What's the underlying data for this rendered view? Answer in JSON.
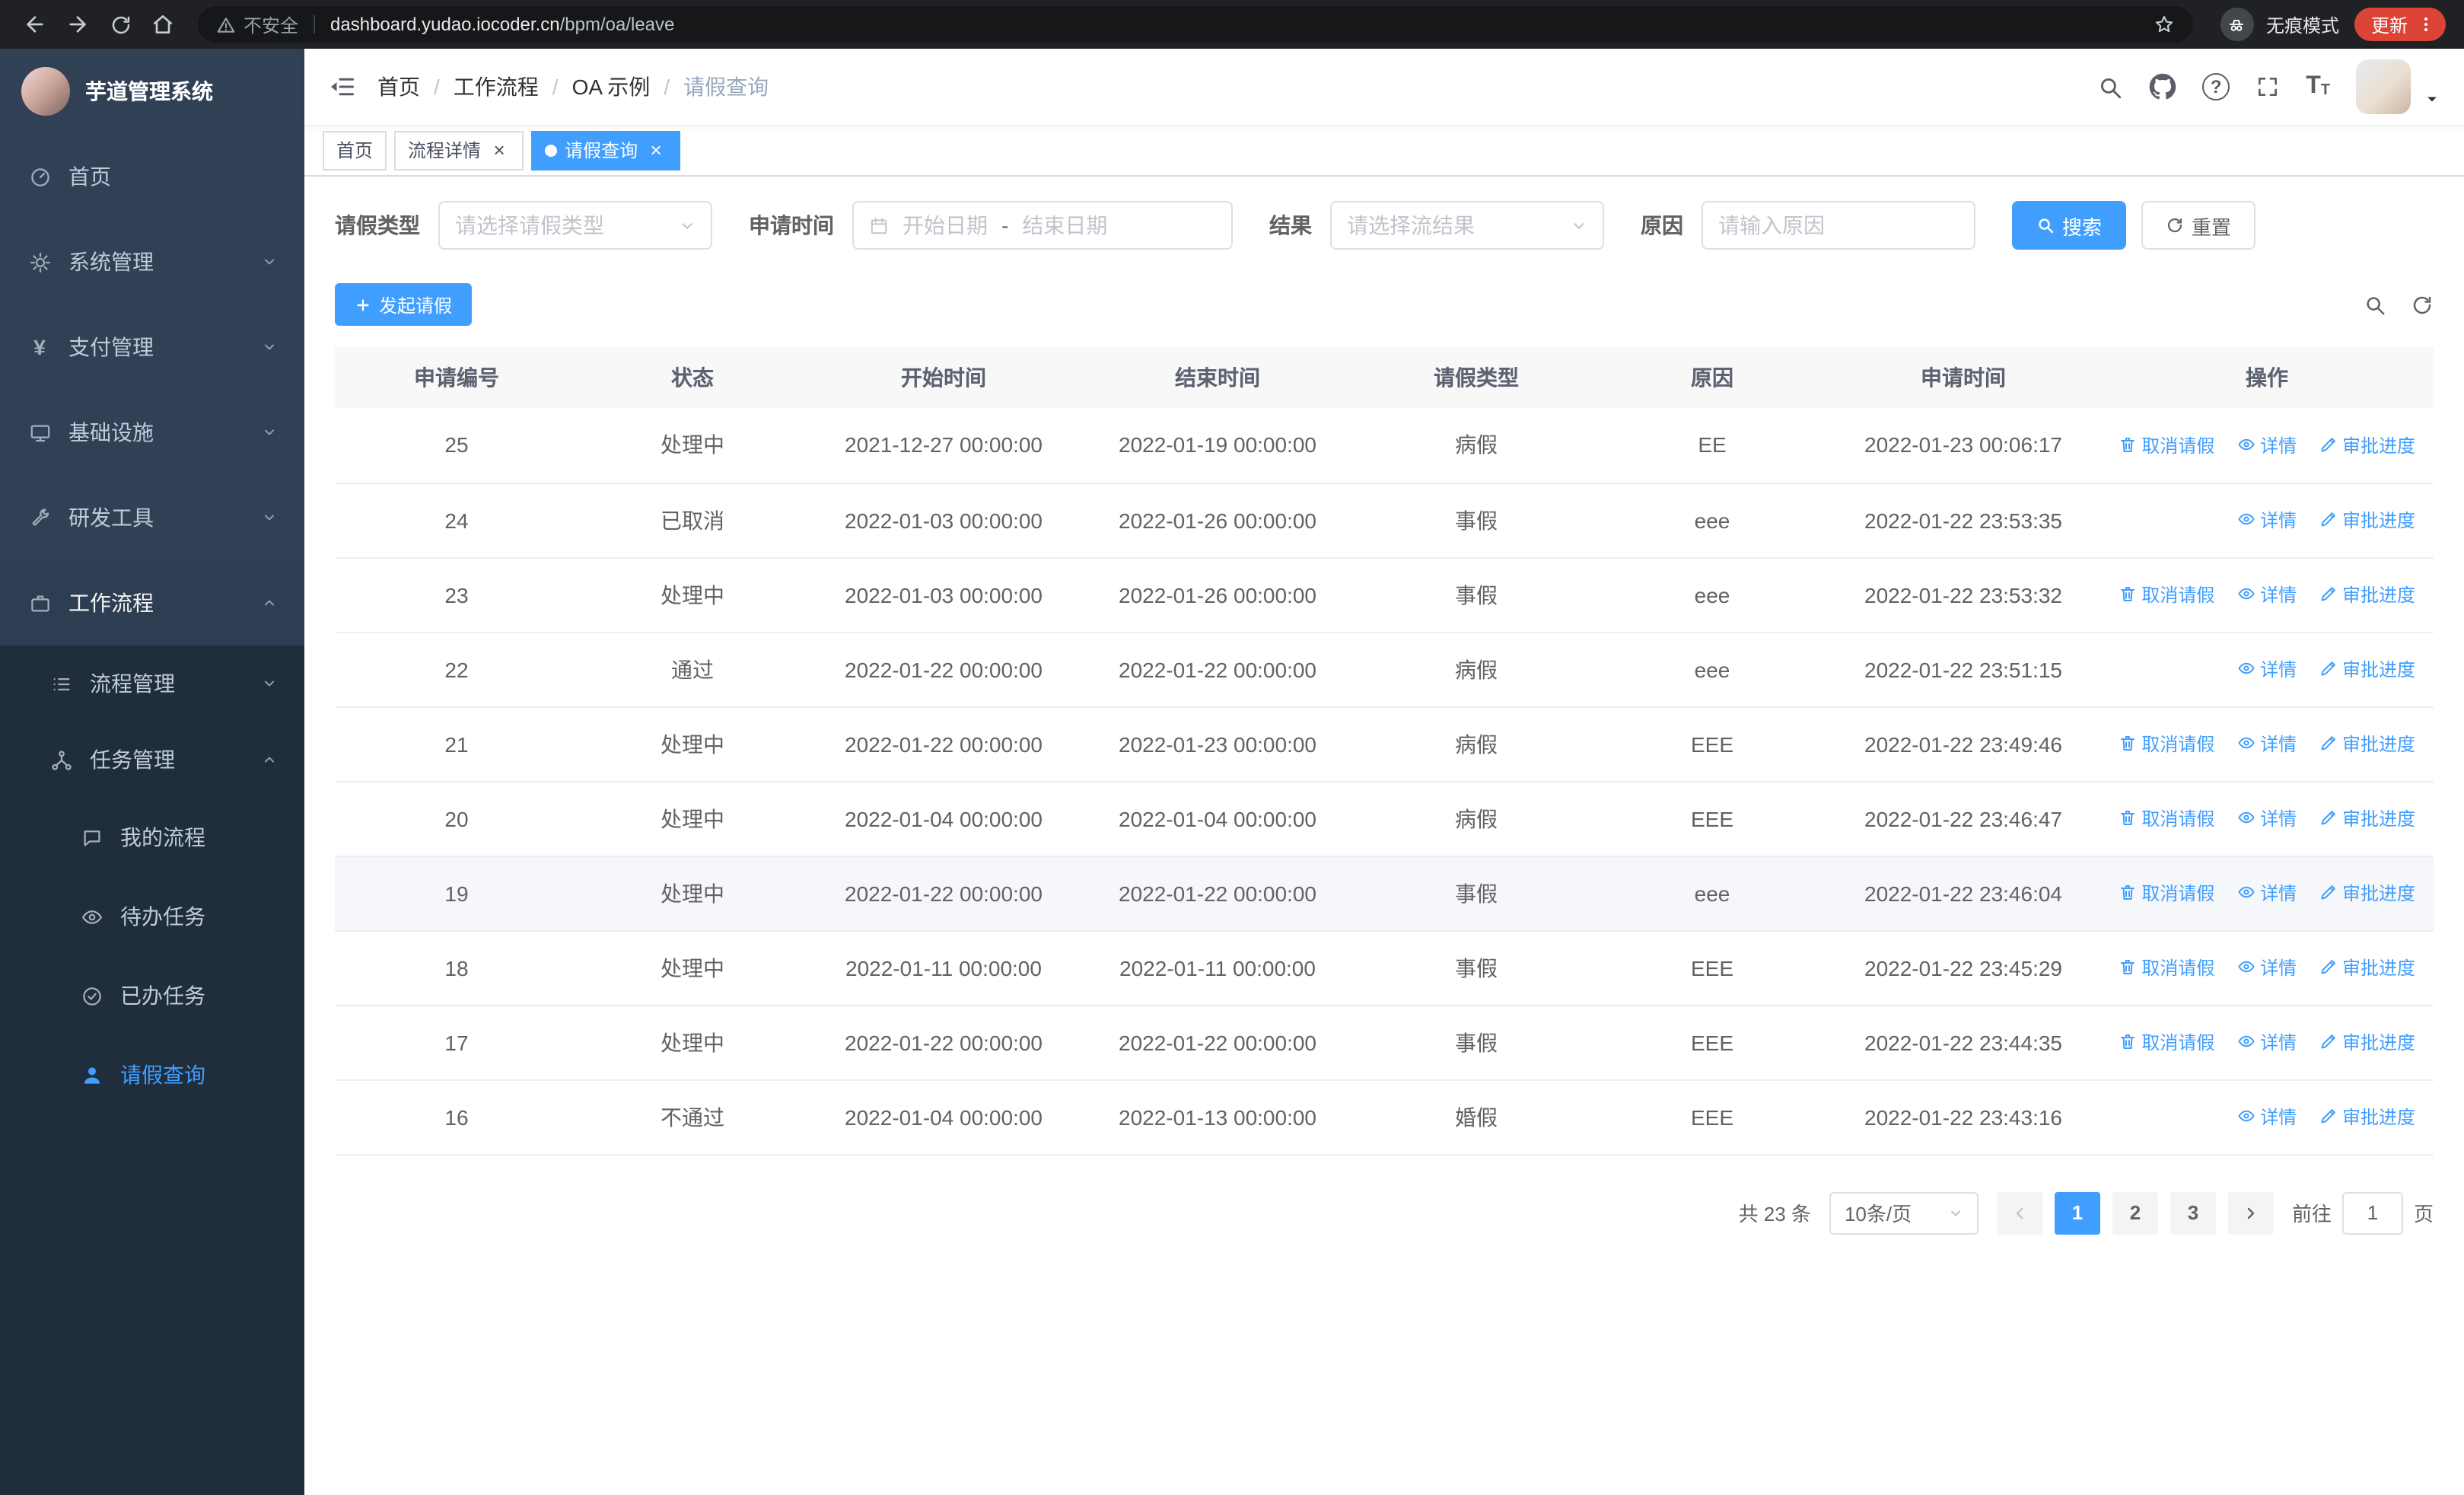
{
  "browser": {
    "security_label": "不安全",
    "url_domain": "dashboard.yudao.iocoder.cn",
    "url_path": "/bpm/oa/leave",
    "incognito_label": "无痕模式",
    "update_label": "更新"
  },
  "sidebar": {
    "title": "芋道管理系统",
    "items": [
      {
        "label": "首页",
        "icon": "dashboard-icon"
      },
      {
        "label": "系统管理",
        "icon": "gear-icon"
      },
      {
        "label": "支付管理",
        "icon": "payment-icon"
      },
      {
        "label": "基础设施",
        "icon": "monitor-icon"
      },
      {
        "label": "研发工具",
        "icon": "tool-icon"
      },
      {
        "label": "工作流程",
        "icon": "workflow-icon",
        "expanded": true
      }
    ],
    "submenu": [
      {
        "label": "流程管理",
        "icon": "process-icon"
      },
      {
        "label": "任务管理",
        "icon": "task-icon",
        "expanded": true
      }
    ],
    "leaves": [
      {
        "label": "我的流程",
        "icon": "chat-icon"
      },
      {
        "label": "待办任务",
        "icon": "eye-icon"
      },
      {
        "label": "已办任务",
        "icon": "done-icon"
      },
      {
        "label": "请假查询",
        "icon": "user-icon",
        "active": true
      }
    ]
  },
  "header": {
    "breadcrumb": [
      "首页",
      "工作流程",
      "OA 示例",
      "请假查询"
    ],
    "separator": "/",
    "help_glyph": "?",
    "font_icon": "T"
  },
  "tabs": {
    "close_glyph": "×",
    "items": [
      {
        "label": "首页",
        "active": false,
        "closable": false
      },
      {
        "label": "流程详情",
        "active": false,
        "closable": true
      },
      {
        "label": "请假查询",
        "active": true,
        "closable": true
      }
    ]
  },
  "filters": {
    "leave_type_label": "请假类型",
    "leave_type_placeholder": "请选择请假类型",
    "apply_time_label": "申请时间",
    "start_date_placeholder": "开始日期",
    "date_separator": "-",
    "end_date_placeholder": "结束日期",
    "result_label": "结果",
    "result_placeholder": "请选择流结果",
    "reason_label": "原因",
    "reason_placeholder": "请输入原因",
    "search_label": "搜索",
    "reset_label": "重置"
  },
  "toolbar": {
    "create_label": "发起请假"
  },
  "table": {
    "columns": [
      "申请编号",
      "状态",
      "开始时间",
      "结束时间",
      "请假类型",
      "原因",
      "申请时间",
      "操作"
    ],
    "action_labels": {
      "cancel": "取消请假",
      "detail": "详情",
      "progress": "审批进度"
    },
    "rows": [
      {
        "id": "25",
        "status": "处理中",
        "start": "2021-12-27 00:00:00",
        "end": "2022-01-19 00:00:00",
        "type": "病假",
        "reason": "EE",
        "apply_time": "2022-01-23 00:06:17",
        "actions": [
          "cancel",
          "detail",
          "progress"
        ]
      },
      {
        "id": "24",
        "status": "已取消",
        "start": "2022-01-03 00:00:00",
        "end": "2022-01-26 00:00:00",
        "type": "事假",
        "reason": "eee",
        "apply_time": "2022-01-22 23:53:35",
        "actions": [
          "detail",
          "progress"
        ]
      },
      {
        "id": "23",
        "status": "处理中",
        "start": "2022-01-03 00:00:00",
        "end": "2022-01-26 00:00:00",
        "type": "事假",
        "reason": "eee",
        "apply_time": "2022-01-22 23:53:32",
        "actions": [
          "cancel",
          "detail",
          "progress"
        ]
      },
      {
        "id": "22",
        "status": "通过",
        "start": "2022-01-22 00:00:00",
        "end": "2022-01-22 00:00:00",
        "type": "病假",
        "reason": "eee",
        "apply_time": "2022-01-22 23:51:15",
        "actions": [
          "detail",
          "progress"
        ]
      },
      {
        "id": "21",
        "status": "处理中",
        "start": "2022-01-22 00:00:00",
        "end": "2022-01-23 00:00:00",
        "type": "病假",
        "reason": "EEE",
        "apply_time": "2022-01-22 23:49:46",
        "actions": [
          "cancel",
          "detail",
          "progress"
        ]
      },
      {
        "id": "20",
        "status": "处理中",
        "start": "2022-01-04 00:00:00",
        "end": "2022-01-04 00:00:00",
        "type": "病假",
        "reason": "EEE",
        "apply_time": "2022-01-22 23:46:47",
        "actions": [
          "cancel",
          "detail",
          "progress"
        ]
      },
      {
        "id": "19",
        "status": "处理中",
        "start": "2022-01-22 00:00:00",
        "end": "2022-01-22 00:00:00",
        "type": "事假",
        "reason": "eee",
        "apply_time": "2022-01-22 23:46:04",
        "actions": [
          "cancel",
          "detail",
          "progress"
        ],
        "highlight": true
      },
      {
        "id": "18",
        "status": "处理中",
        "start": "2022-01-11 00:00:00",
        "end": "2022-01-11 00:00:00",
        "type": "事假",
        "reason": "EEE",
        "apply_time": "2022-01-22 23:45:29",
        "actions": [
          "cancel",
          "detail",
          "progress"
        ]
      },
      {
        "id": "17",
        "status": "处理中",
        "start": "2022-01-22 00:00:00",
        "end": "2022-01-22 00:00:00",
        "type": "事假",
        "reason": "EEE",
        "apply_time": "2022-01-22 23:44:35",
        "actions": [
          "cancel",
          "detail",
          "progress"
        ]
      },
      {
        "id": "16",
        "status": "不通过",
        "start": "2022-01-04 00:00:00",
        "end": "2022-01-13 00:00:00",
        "type": "婚假",
        "reason": "EEE",
        "apply_time": "2022-01-22 23:43:16",
        "actions": [
          "detail",
          "progress"
        ]
      }
    ]
  },
  "pagination": {
    "total_label": "共 23 条",
    "page_size_label": "10条/页",
    "pages": [
      "1",
      "2",
      "3"
    ],
    "active_page": "1",
    "goto_label": "前往",
    "goto_value": "1",
    "page_unit": "页"
  },
  "colors": {
    "primary": "#409eff",
    "sidebar_bg": "#304156",
    "submenu_bg": "#1f2d3d",
    "chrome_bg": "#202124",
    "update_red": "#db4437"
  }
}
